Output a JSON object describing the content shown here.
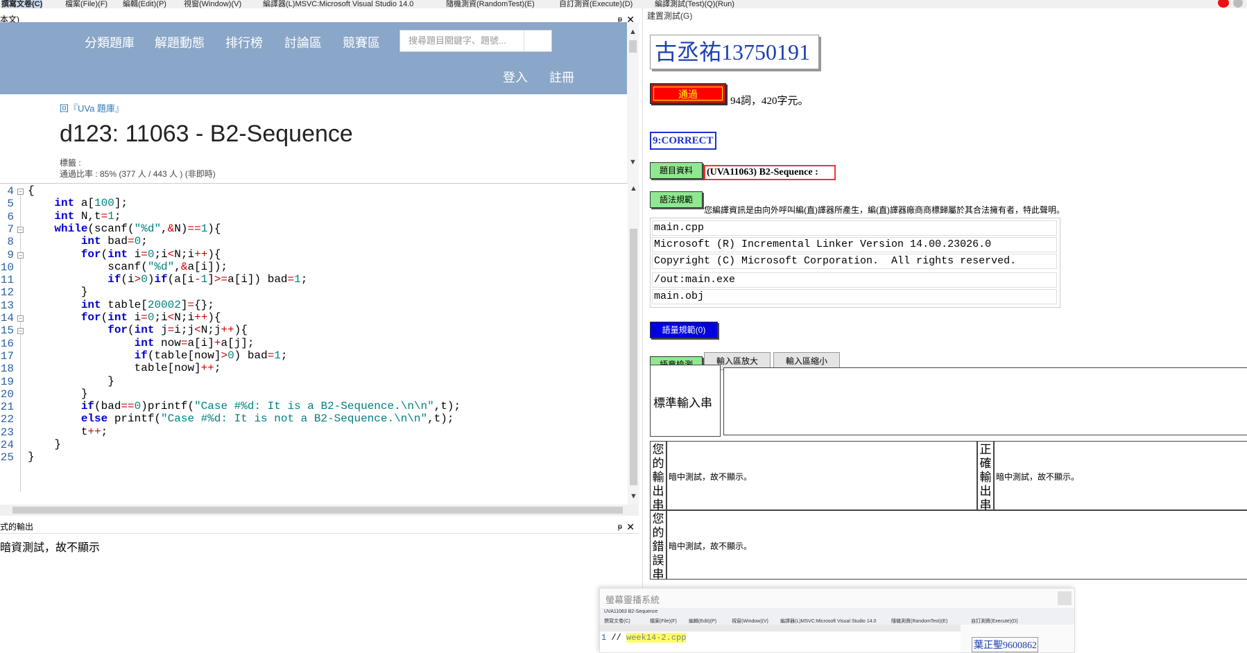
{
  "menubar": {
    "items": [
      "撰寫文卷(C)",
      "檔案(File)(F)",
      "編輯(Edit)(P)",
      "視窗(Window)(V)",
      "編譯器(L)MSVC:Microsoft Visual Studio 14.0",
      "隨機測資(RandomTest)(E)",
      "自訂測資(Execute)(D)",
      "編譯測試(Test)(Q)(Run)"
    ]
  },
  "left_panel": {
    "title": "本文)",
    "pin": "ᵽ",
    "close": "✕"
  },
  "web": {
    "nav": [
      "分類題庫",
      "解題動態",
      "排行榜",
      "討論區",
      "競賽區"
    ],
    "search_placeholder": "搜尋題目關鍵字、題號...",
    "login": "登入",
    "register": "註冊",
    "back_link": "回『UVa 題庫』",
    "problem_title": "d123: 11063 - B2-Sequence",
    "tags": "標籤 :",
    "pass_rate": "通過比率 : 85% (377 人 / 443 人 ) (非即時)"
  },
  "editor": {
    "line_numbers": [
      "4",
      "5",
      "6",
      "7",
      "8",
      "9",
      "10",
      "11",
      "12",
      "13",
      "14",
      "15",
      "16",
      "17",
      "18",
      "19",
      "20",
      "21",
      "22",
      "23",
      "24",
      "25"
    ],
    "lines": [
      "{",
      "    int a[100];",
      "    int N,t=1;",
      "    while(scanf(\"%d\",&N)==1){",
      "        int bad=0;",
      "        for(int i=0;i<N;i++){",
      "            scanf(\"%d\",&a[i]);",
      "            if(i>0)if(a[i-1]>=a[i]) bad=1;",
      "        }",
      "        int table[20002]={};",
      "        for(int i=0;i<N;i++){",
      "            for(int j=i;j<N;j++){",
      "                int now=a[i]+a[j];",
      "                if(table[now]>0) bad=1;",
      "                table[now]++;",
      "            }",
      "        }",
      "        if(bad==0)printf(\"Case #%d: It is a B2-Sequence.\\n\\n\",t);",
      "        else printf(\"Case #%d: It is not a B2-Sequence.\\n\\n\",t);",
      "        t++;",
      "    }",
      "}"
    ]
  },
  "output_panel": {
    "title": "式的輸出",
    "text": "暗資測試，故不顯示"
  },
  "right_panel": {
    "title": "建置測試(G)",
    "user": "古丞祐13750191",
    "pass_label": "通過",
    "stats": "94詞，420字元。",
    "correct": "9:CORRECT",
    "probinfo_btn": "題目資料",
    "probinfo": "(UVA11063) B2-Sequence :",
    "syntax_btn": "語法規範",
    "syntax_note": "您編譯資訊是由向外呼叫編(直)譯器所產生，編(直)譯器廠商商標歸屬於其合法擁有者，特此聲明。",
    "compile_lines": [
      "main.cpp",
      "Microsoft (R) Incremental Linker Version 14.00.23026.0",
      "Copyright (C) Microsoft Corporation.  All rights reserved.",
      "/out:main.exe",
      "main.obj"
    ],
    "semantic_btn": "語量規範(0)",
    "check_btn": "語意檢測",
    "enlarge_btn": "輸入區放大",
    "shrink_btn": "輸入區縮小",
    "std_input_label": "標準輸入串",
    "your_output_label": "您的輸出串",
    "correct_output_label": "正確輸出串",
    "your_error_label": "您的錯誤串",
    "hidden_text": "暗中測試，故不顯示。"
  },
  "overlay": {
    "title": "螢幕靈播系統",
    "code_comment": "week14-2.cpp",
    "user": "葉正聖9600862"
  }
}
